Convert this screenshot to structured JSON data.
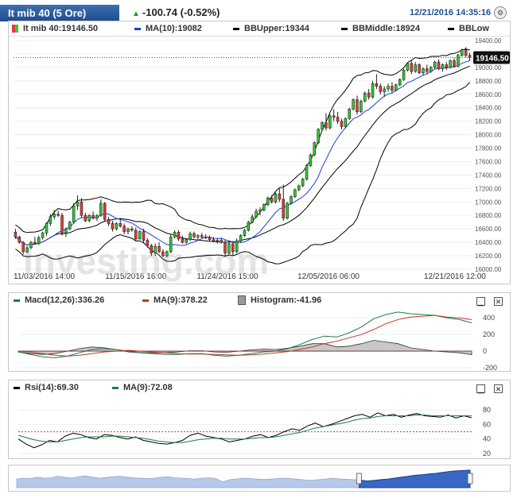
{
  "header": {
    "title": "It mib 40 (5 Ore)",
    "change": "-100.74 (-0.52%)",
    "datetime": "12/21/2016 14:35:16",
    "settings_icon": "settings-icon"
  },
  "colors": {
    "up": "#2ecc2e",
    "down": "#e43a3a",
    "ma": "#1c3fd1",
    "bb": "#000000",
    "macd": "#1f7a4a",
    "signal": "#c0392b",
    "histogram": "#9a9a9a",
    "rsi": "#000000",
    "rsi_ma": "#1f7a4a",
    "navigator": "#3a66c4"
  },
  "main_legend": {
    "price": "It mib 40:19146.50",
    "ma": "MA(10):19082",
    "bb_upper": "BBUpper:19344",
    "bb_middle": "BBMiddle:18924",
    "bb_lower": "BBLow"
  },
  "macd_legend": {
    "macd": "Macd(12,26):336.26",
    "ma": "MA(9):378.22",
    "histogram": "Histogram:-41.96"
  },
  "rsi_legend": {
    "rsi": "Rsi(14):69.30",
    "ma": "MA(9):72.08"
  },
  "watermark": "Investing.com",
  "chart_data": [
    {
      "type": "candlestick",
      "title": "It mib 40",
      "ylim": [
        16000,
        19400
      ],
      "yticks": [
        19400,
        19200,
        19000,
        18800,
        18600,
        18400,
        18200,
        18000,
        17800,
        17600,
        17400,
        17200,
        17000,
        16800,
        16600,
        16400,
        16200,
        16000
      ],
      "ytick_labels": [
        "19400.00",
        "19200.00",
        "19000.00",
        "18800.00",
        "18600.00",
        "18400.00",
        "18200.00",
        "18000.00",
        "17800.00",
        "17600.00",
        "17400.00",
        "17200.00",
        "17000.00",
        "16800.00",
        "16600.00",
        "16400.00",
        "16200.00",
        "16000.00"
      ],
      "xtick_labels": [
        "11/03/2016 14:00",
        "11/15/2016 16:00",
        "11/24/2016 15:00",
        "12/05/2016 06:00",
        "12/21/2016 12:00"
      ],
      "last_price_label": "19146.50",
      "last_price": 19146.5,
      "candles": [
        [
          16550,
          16600,
          16450,
          16480
        ],
        [
          16480,
          16500,
          16380,
          16400
        ],
        [
          16400,
          16420,
          16220,
          16260
        ],
        [
          16260,
          16350,
          16240,
          16320
        ],
        [
          16320,
          16420,
          16300,
          16400
        ],
        [
          16400,
          16480,
          16360,
          16380
        ],
        [
          16380,
          16500,
          16360,
          16470
        ],
        [
          16470,
          16560,
          16440,
          16540
        ],
        [
          16540,
          16700,
          16500,
          16680
        ],
        [
          16680,
          16820,
          16640,
          16780
        ],
        [
          16780,
          16880,
          16740,
          16820
        ],
        [
          16820,
          16870,
          16780,
          16800
        ],
        [
          16800,
          16840,
          16500,
          16540
        ],
        [
          16540,
          16620,
          16480,
          16600
        ],
        [
          16600,
          16720,
          16580,
          16700
        ],
        [
          16700,
          16980,
          16680,
          16940
        ],
        [
          16940,
          17100,
          16880,
          17000
        ],
        [
          17000,
          17060,
          16760,
          16800
        ],
        [
          16800,
          16840,
          16700,
          16720
        ],
        [
          16720,
          16820,
          16700,
          16800
        ],
        [
          16800,
          16860,
          16740,
          16760
        ],
        [
          16760,
          16820,
          16720,
          16800
        ],
        [
          16800,
          17040,
          16780,
          16980
        ],
        [
          16980,
          17000,
          16720,
          16740
        ],
        [
          16740,
          16780,
          16640,
          16680
        ],
        [
          16680,
          16720,
          16560,
          16600
        ],
        [
          16600,
          16700,
          16580,
          16680
        ],
        [
          16680,
          16760,
          16620,
          16640
        ],
        [
          16640,
          16680,
          16520,
          16560
        ],
        [
          16560,
          16620,
          16520,
          16600
        ],
        [
          16600,
          16640,
          16560,
          16580
        ],
        [
          16580,
          16620,
          16420,
          16450
        ],
        [
          16450,
          16580,
          16440,
          16560
        ],
        [
          16560,
          16600,
          16400,
          16430
        ],
        [
          16430,
          16460,
          16320,
          16350
        ],
        [
          16350,
          16380,
          16200,
          16240
        ],
        [
          16240,
          16380,
          16200,
          16340
        ],
        [
          16340,
          16400,
          16240,
          16260
        ],
        [
          16260,
          16300,
          16180,
          16200
        ],
        [
          16200,
          16280,
          16180,
          16260
        ],
        [
          16260,
          16520,
          16240,
          16480
        ],
        [
          16480,
          16580,
          16460,
          16550
        ],
        [
          16550,
          16580,
          16420,
          16450
        ],
        [
          16450,
          16500,
          16380,
          16400
        ],
        [
          16400,
          16460,
          16380,
          16440
        ],
        [
          16440,
          16560,
          16420,
          16530
        ],
        [
          16530,
          16560,
          16460,
          16480
        ],
        [
          16480,
          16520,
          16440,
          16500
        ],
        [
          16500,
          16540,
          16460,
          16480
        ],
        [
          16480,
          16520,
          16450,
          16470
        ],
        [
          16470,
          16500,
          16420,
          16440
        ],
        [
          16440,
          16480,
          16400,
          16420
        ],
        [
          16420,
          16460,
          16380,
          16430
        ],
        [
          16430,
          16470,
          16380,
          16400
        ],
        [
          16400,
          16440,
          16200,
          16240
        ],
        [
          16240,
          16420,
          16220,
          16380
        ],
        [
          16380,
          16420,
          16200,
          16260
        ],
        [
          16260,
          16460,
          16240,
          16420
        ],
        [
          16420,
          16520,
          16400,
          16500
        ],
        [
          16500,
          16600,
          16480,
          16580
        ],
        [
          16580,
          16720,
          16560,
          16700
        ],
        [
          16700,
          16820,
          16680,
          16780
        ],
        [
          16780,
          16900,
          16760,
          16860
        ],
        [
          16860,
          16920,
          16800,
          16880
        ],
        [
          16880,
          16980,
          16860,
          16960
        ],
        [
          16960,
          17080,
          16940,
          17060
        ],
        [
          17060,
          17100,
          16980,
          17000
        ],
        [
          17000,
          17140,
          16980,
          17120
        ],
        [
          17120,
          17200,
          17000,
          17040
        ],
        [
          17040,
          17260,
          16720,
          16760
        ],
        [
          16760,
          17000,
          16740,
          16980
        ],
        [
          16980,
          17100,
          16960,
          17080
        ],
        [
          17080,
          17200,
          17060,
          17180
        ],
        [
          17180,
          17260,
          17160,
          17240
        ],
        [
          17240,
          17360,
          17220,
          17340
        ],
        [
          17340,
          17560,
          17320,
          17540
        ],
        [
          17540,
          17720,
          17520,
          17700
        ],
        [
          17700,
          17900,
          17680,
          17880
        ],
        [
          17880,
          18100,
          17860,
          18080
        ],
        [
          18080,
          18200,
          18060,
          18180
        ],
        [
          18180,
          18320,
          18060,
          18100
        ],
        [
          18100,
          18300,
          18080,
          18280
        ],
        [
          18280,
          18380,
          18200,
          18260
        ],
        [
          18260,
          18340,
          18160,
          18200
        ],
        [
          18200,
          18240,
          18080,
          18120
        ],
        [
          18120,
          18260,
          18100,
          18240
        ],
        [
          18240,
          18400,
          18220,
          18380
        ],
        [
          18380,
          18540,
          18360,
          18520
        ],
        [
          18520,
          18580,
          18300,
          18340
        ],
        [
          18340,
          18520,
          18320,
          18500
        ],
        [
          18500,
          18640,
          18480,
          18620
        ],
        [
          18620,
          18680,
          18520,
          18560
        ],
        [
          18560,
          18800,
          18540,
          18760
        ],
        [
          18760,
          18900,
          18680,
          18720
        ],
        [
          18720,
          18760,
          18600,
          18640
        ],
        [
          18640,
          18720,
          18560,
          18680
        ],
        [
          18680,
          18760,
          18640,
          18720
        ],
        [
          18720,
          18780,
          18620,
          18660
        ],
        [
          18660,
          18760,
          18640,
          18740
        ],
        [
          18740,
          18840,
          18720,
          18820
        ],
        [
          18820,
          18980,
          18800,
          18960
        ],
        [
          18960,
          19080,
          18940,
          19060
        ],
        [
          19060,
          19100,
          18900,
          18940
        ],
        [
          18940,
          19080,
          18920,
          19040
        ],
        [
          19040,
          19060,
          18900,
          18920
        ],
        [
          18920,
          19000,
          18880,
          18980
        ],
        [
          18980,
          19040,
          18900,
          18940
        ],
        [
          18940,
          19020,
          18920,
          19000
        ],
        [
          19000,
          19100,
          18980,
          19080
        ],
        [
          19080,
          19120,
          18960,
          18980
        ],
        [
          18980,
          19060,
          18940,
          19040
        ],
        [
          19040,
          19080,
          18960,
          19000
        ],
        [
          19000,
          19120,
          18980,
          19100
        ],
        [
          19100,
          19140,
          19000,
          19020
        ],
        [
          19020,
          19200,
          19000,
          19180
        ],
        [
          19180,
          19280,
          19160,
          19260
        ],
        [
          19260,
          19300,
          19150,
          19180
        ],
        [
          19180,
          19220,
          19100,
          19146.5
        ]
      ]
    },
    {
      "type": "line",
      "title": "Macd(12,26)",
      "ylim": [
        -200,
        450
      ],
      "yticks": [
        400,
        200,
        0,
        -200
      ],
      "ytick_labels": [
        "400",
        "200",
        "0",
        "-200"
      ],
      "series": [
        {
          "name": "Macd(12,26)",
          "values": [
            -10,
            -40,
            -70,
            -80,
            -60,
            -20,
            20,
            30,
            20,
            0,
            -20,
            -30,
            -40,
            -40,
            -30,
            -30,
            -50,
            -60,
            -50,
            -30,
            -10,
            0,
            30,
            80,
            140,
            180,
            170,
            220,
            290,
            390,
            440,
            470,
            450,
            440,
            430,
            400,
            380,
            340
          ]
        },
        {
          "name": "MA(9)",
          "values": [
            0,
            -10,
            -30,
            -50,
            -60,
            -50,
            -30,
            -10,
            0,
            10,
            0,
            -10,
            -20,
            -30,
            -35,
            -35,
            -40,
            -45,
            -50,
            -45,
            -35,
            -20,
            -5,
            20,
            50,
            90,
            120,
            160,
            200,
            260,
            330,
            380,
            410,
            420,
            430,
            410,
            400,
            378
          ]
        }
      ],
      "histogram": [
        -10,
        -30,
        -40,
        -30,
        0,
        30,
        50,
        40,
        20,
        -10,
        -20,
        -20,
        -20,
        -10,
        5,
        5,
        -10,
        -15,
        0,
        15,
        25,
        20,
        35,
        60,
        90,
        90,
        50,
        60,
        90,
        130,
        110,
        90,
        40,
        20,
        0,
        -10,
        -20,
        -42
      ]
    },
    {
      "type": "line",
      "title": "Rsi(14)",
      "ylim": [
        20,
        90
      ],
      "yticks": [
        80,
        60,
        40,
        20
      ],
      "ytick_labels": [
        "80",
        "60",
        "40",
        "20"
      ],
      "reference_line": 50,
      "series": [
        {
          "name": "Rsi(14)",
          "values": [
            40,
            33,
            28,
            32,
            38,
            36,
            44,
            48,
            46,
            42,
            40,
            46,
            45,
            42,
            40,
            43,
            38,
            36,
            34,
            33,
            35,
            38,
            45,
            48,
            44,
            42,
            40,
            36,
            38,
            40,
            44,
            46,
            42,
            45,
            50,
            54,
            52,
            58,
            62,
            57,
            60,
            64,
            68,
            72,
            74,
            70,
            76,
            72,
            74,
            70,
            73,
            75,
            72,
            71,
            70,
            73,
            69,
            72,
            69.3
          ]
        },
        {
          "name": "MA(9)",
          "values": [
            45,
            42,
            39,
            37,
            36,
            36,
            38,
            40,
            42,
            43,
            43,
            43,
            44,
            44,
            43,
            42,
            41,
            39,
            37,
            36,
            35,
            35,
            37,
            39,
            40,
            41,
            41,
            40,
            40,
            40,
            41,
            42,
            42,
            43,
            45,
            47,
            49,
            52,
            55,
            57,
            59,
            61,
            63,
            66,
            68,
            69,
            71,
            72,
            72,
            72,
            72,
            73,
            73,
            72,
            72,
            72,
            72,
            72,
            72.08
          ]
        }
      ]
    }
  ],
  "navigator": {
    "values": [
      0.45,
      0.5,
      0.48,
      0.55,
      0.5,
      0.52,
      0.6,
      0.55,
      0.5,
      0.58,
      0.62,
      0.55,
      0.5,
      0.53,
      0.58,
      0.6,
      0.55,
      0.52,
      0.5,
      0.48,
      0.5,
      0.54,
      0.57,
      0.52,
      0.5,
      0.48,
      0.45,
      0.5,
      0.52,
      0.48,
      0.3,
      0.42,
      0.45,
      0.5,
      0.48,
      0.45,
      0.43,
      0.45,
      0.48,
      0.5,
      0.47,
      0.44,
      0.4,
      0.38,
      0.42,
      0.45,
      0.5,
      0.46,
      0.44,
      0.42,
      0.4,
      0.35,
      0.38,
      0.42,
      0.45,
      0.5,
      0.55,
      0.6,
      0.65,
      0.68,
      0.72,
      0.75,
      0.8,
      0.85,
      0.88,
      0.9,
      0.92
    ],
    "selection_start": 0.755,
    "selection_end": 0.92
  }
}
